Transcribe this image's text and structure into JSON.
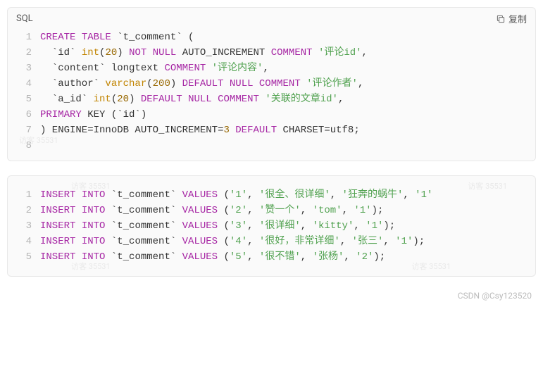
{
  "block1": {
    "lang": "SQL",
    "copyLabel": "复制",
    "lines": [
      "<span class=\"kw\">CREATE</span> <span class=\"kw\">TABLE</span> `t_comment` (",
      "  `id` <span class=\"type\">int</span>(<span class=\"num\">20</span>) <span class=\"kw\">NOT</span> <span class=\"kw\">NULL</span> AUTO_INCREMENT <span class=\"kw\">COMMENT</span> <span class=\"str\">'评论id'</span>,",
      "  `content` longtext <span class=\"kw\">COMMENT</span> <span class=\"str\">'评论内容'</span>,",
      "  `author` <span class=\"type\">varchar</span>(<span class=\"num\">200</span>) <span class=\"kw\">DEFAULT</span> <span class=\"kw\">NULL</span> <span class=\"kw\">COMMENT</span> <span class=\"str\">'评论作者'</span>,",
      "  `a_id` <span class=\"type\">int</span>(<span class=\"num\">20</span>) <span class=\"kw\">DEFAULT</span> <span class=\"kw\">NULL</span> <span class=\"kw\">COMMENT</span> <span class=\"str\">'关联的文章id'</span>,",
      "<span class=\"kw\">PRIMARY</span> KEY (`id`)",
      ") ENGINE<span class=\"pl\">=</span>InnoDB AUTO_INCREMENT<span class=\"pl\">=</span><span class=\"num\">3</span> <span class=\"kw\">DEFAULT</span> CHARSET<span class=\"pl\">=</span>utf8;",
      ""
    ]
  },
  "block2": {
    "lines": [
      "<span class=\"kw\">INSERT</span> <span class=\"kw\">INTO</span> `t_comment` <span class=\"kw\">VALUES</span> (<span class=\"str\">'1'</span>, <span class=\"str\">'很全、很详细'</span>, <span class=\"str\">'狂奔的蜗牛'</span>, <span class=\"str\">'1'</span>",
      "<span class=\"kw\">INSERT</span> <span class=\"kw\">INTO</span> `t_comment` <span class=\"kw\">VALUES</span> (<span class=\"str\">'2'</span>, <span class=\"str\">'赞一个'</span>, <span class=\"str\">'tom'</span>, <span class=\"str\">'1'</span>);",
      "<span class=\"kw\">INSERT</span> <span class=\"kw\">INTO</span> `t_comment` <span class=\"kw\">VALUES</span> (<span class=\"str\">'3'</span>, <span class=\"str\">'很详细'</span>, <span class=\"str\">'kitty'</span>, <span class=\"str\">'1'</span>);",
      "<span class=\"kw\">INSERT</span> <span class=\"kw\">INTO</span> `t_comment` <span class=\"kw\">VALUES</span> (<span class=\"str\">'4'</span>, <span class=\"str\">'很好，非常详细'</span>, <span class=\"str\">'张三'</span>, <span class=\"str\">'1'</span>);",
      "<span class=\"kw\">INSERT</span> <span class=\"kw\">INTO</span> `t_comment` <span class=\"kw\">VALUES</span> (<span class=\"str\">'5'</span>, <span class=\"str\">'很不错'</span>, <span class=\"str\">'张杨'</span>, <span class=\"str\">'2'</span>);"
    ]
  },
  "watermarkText": "访客 35531",
  "footer": "CSDN @Csy123520"
}
